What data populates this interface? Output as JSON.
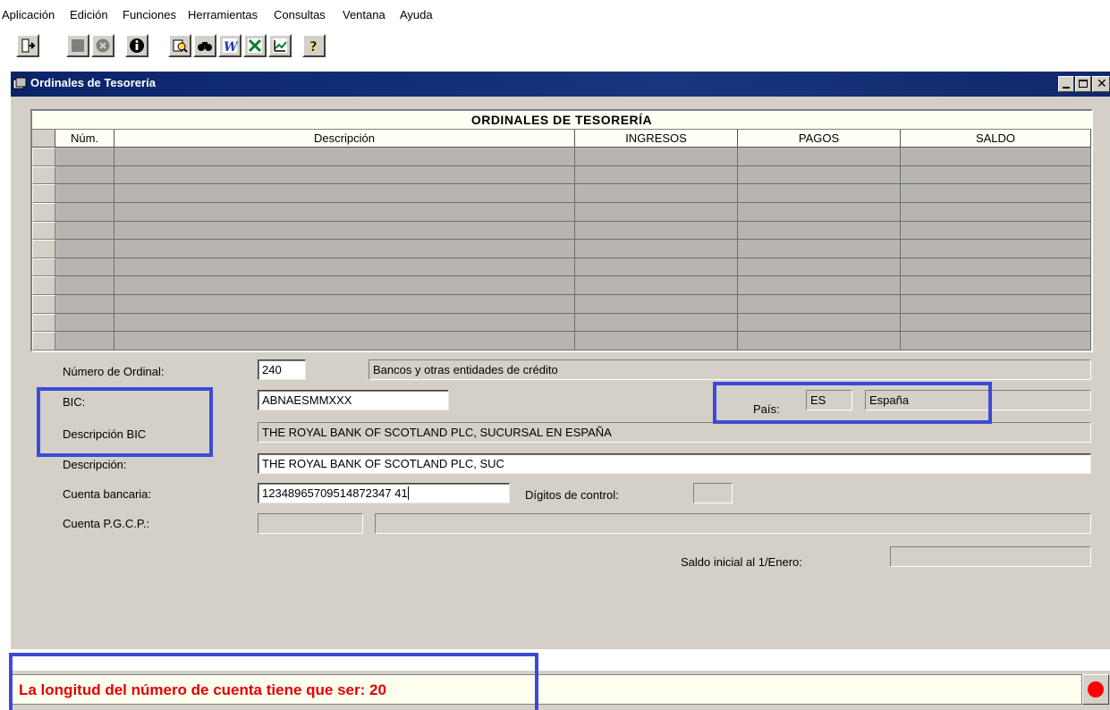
{
  "menu": [
    "Aplicación",
    "Edición",
    "Funciones",
    "Herramientas",
    "Consultas",
    "Ventana",
    "Ayuda"
  ],
  "toolbar": {
    "icons": [
      "exit-icon",
      "stop-icon",
      "cancel-icon",
      "info-icon",
      "print-preview-icon",
      "find-icon",
      "word-icon",
      "excel-icon",
      "chart-icon",
      "help-icon"
    ]
  },
  "window": {
    "title": "Ordinales de Tesorería"
  },
  "grid": {
    "title": "ORDINALES DE TESORERÍA",
    "columns": [
      "Núm.",
      "Descripción",
      "INGRESOS",
      "PAGOS",
      "SALDO"
    ],
    "row_count": 11
  },
  "form": {
    "numero_ordinal": {
      "label": "Número de Ordinal:",
      "value": "240",
      "desc": "Bancos y otras entidades de crédito"
    },
    "bic": {
      "label": "BIC:",
      "value": "ABNAESMMXXX"
    },
    "pais": {
      "label": "País:",
      "code": "ES",
      "name": "España"
    },
    "descripcion_bic": {
      "label": "Descripción BIC",
      "value": "THE ROYAL BANK OF SCOTLAND PLC, SUCURSAL EN ESPAÑA"
    },
    "descripcion": {
      "label": "Descripción:",
      "value": "THE ROYAL BANK OF SCOTLAND PLC, SUC"
    },
    "cuenta_bancaria": {
      "label": "Cuenta bancaria:",
      "value": "12348965709514872347 41"
    },
    "digitos_control": {
      "label": "Dígitos de control:",
      "value": ""
    },
    "cuenta_pgcp": {
      "label": "Cuenta P.G.C.P.:",
      "code": "",
      "desc": ""
    },
    "saldo_inicial": {
      "label": "Saldo inicial al 1/Enero:",
      "value": ""
    }
  },
  "status": {
    "message": "La longitud del número de cuenta tiene que ser: 20",
    "message_color": "#e20000",
    "light_color": "#ff0000"
  },
  "colors": {
    "title_bar": "#0a246a",
    "highlight": "#3c4ad8",
    "window_bg": "#d4d0c8"
  }
}
